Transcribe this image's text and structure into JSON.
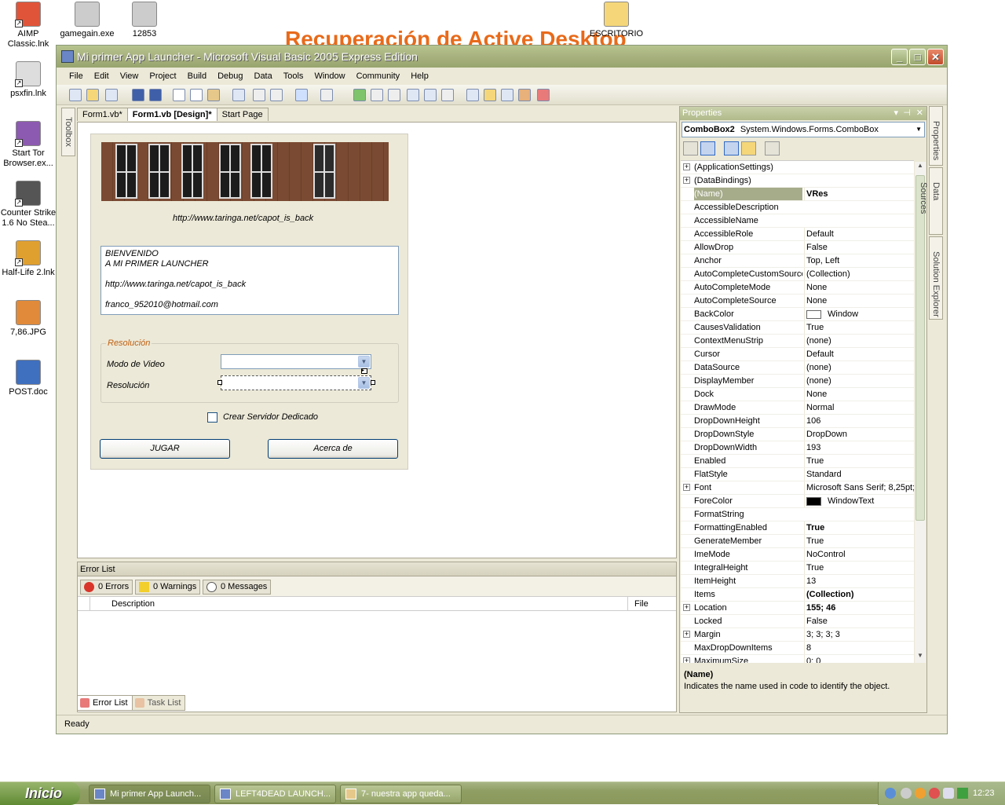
{
  "desktop": {
    "background_title": "Recuperación de Active Desktop",
    "icons": [
      {
        "label": "AIMP Classic.lnk",
        "icon": "aimp-icon"
      },
      {
        "label": "gamegain.exe",
        "icon": "recycle-icon"
      },
      {
        "label": "12853",
        "icon": "image-file-icon"
      },
      {
        "label": "ESCRITORIO",
        "icon": "folder-icon"
      },
      {
        "label": "psxfin.lnk",
        "icon": "psx-icon"
      },
      {
        "label": "Start Tor Browser.ex...",
        "icon": "tor-icon"
      },
      {
        "label": "Counter Strike 1.6 No Stea...",
        "icon": "cs-icon"
      },
      {
        "label": "Half-Life 2.lnk",
        "icon": "halflife-icon"
      },
      {
        "label": "7,86.JPG",
        "icon": "jpg-icon"
      },
      {
        "label": "POST.doc",
        "icon": "word-icon"
      }
    ]
  },
  "window": {
    "title": "Mi primer App Launcher - Microsoft Visual Basic 2005 Express Edition",
    "menu": [
      "File",
      "Edit",
      "View",
      "Project",
      "Build",
      "Debug",
      "Data",
      "Tools",
      "Window",
      "Community",
      "Help"
    ],
    "toolbox_label": "Toolbox",
    "tabs": [
      "Form1.vb*",
      "Form1.vb [Design]*",
      "Start Page"
    ],
    "status": "Ready"
  },
  "form": {
    "url_label": "http://www.taringa.net/capot_is_back",
    "textbox_lines": [
      "BIENVENIDO",
      "A MI PRIMER LAUNCHER",
      "",
      "http://www.taringa.net/capot_is_back",
      "",
      "franco_952010@hotmail.com"
    ],
    "group_title": "Resolución",
    "modo_label": "Modo de Video",
    "resolucion_label": "Resolución",
    "checkbox_label": "Crear Servidor Dedicado",
    "play_button": "JUGAR",
    "about_button": "Acerca de"
  },
  "error_list": {
    "title": "Error List",
    "errors": "0 Errors",
    "warnings": "0 Warnings",
    "messages": "0 Messages",
    "col_description": "Description",
    "col_file": "File",
    "tab_error": "Error List",
    "tab_task": "Task List"
  },
  "properties": {
    "title": "Properties",
    "object_name": "ComboBox2",
    "object_type": "System.Windows.Forms.ComboBox",
    "rows": [
      {
        "name": "(ApplicationSettings)",
        "value": "",
        "expand": true
      },
      {
        "name": "(DataBindings)",
        "value": "",
        "expand": true
      },
      {
        "name": "(Name)",
        "value": "VRes",
        "selected": true,
        "bold": true
      },
      {
        "name": "AccessibleDescription",
        "value": ""
      },
      {
        "name": "AccessibleName",
        "value": ""
      },
      {
        "name": "AccessibleRole",
        "value": "Default"
      },
      {
        "name": "AllowDrop",
        "value": "False"
      },
      {
        "name": "Anchor",
        "value": "Top, Left"
      },
      {
        "name": "AutoCompleteCustomSource",
        "value": "(Collection)"
      },
      {
        "name": "AutoCompleteMode",
        "value": "None"
      },
      {
        "name": "AutoCompleteSource",
        "value": "None"
      },
      {
        "name": "BackColor",
        "value": "Window",
        "swatch": "#ffffff"
      },
      {
        "name": "CausesValidation",
        "value": "True"
      },
      {
        "name": "ContextMenuStrip",
        "value": "(none)"
      },
      {
        "name": "Cursor",
        "value": "Default"
      },
      {
        "name": "DataSource",
        "value": "(none)"
      },
      {
        "name": "DisplayMember",
        "value": "(none)"
      },
      {
        "name": "Dock",
        "value": "None"
      },
      {
        "name": "DrawMode",
        "value": "Normal"
      },
      {
        "name": "DropDownHeight",
        "value": "106"
      },
      {
        "name": "DropDownStyle",
        "value": "DropDown"
      },
      {
        "name": "DropDownWidth",
        "value": "193"
      },
      {
        "name": "Enabled",
        "value": "True"
      },
      {
        "name": "FlatStyle",
        "value": "Standard"
      },
      {
        "name": "Font",
        "value": "Microsoft Sans Serif; 8,25pt;",
        "expand": true
      },
      {
        "name": "ForeColor",
        "value": "WindowText",
        "swatch": "#000000"
      },
      {
        "name": "FormatString",
        "value": ""
      },
      {
        "name": "FormattingEnabled",
        "value": "True",
        "bold": true
      },
      {
        "name": "GenerateMember",
        "value": "True"
      },
      {
        "name": "ImeMode",
        "value": "NoControl"
      },
      {
        "name": "IntegralHeight",
        "value": "True"
      },
      {
        "name": "ItemHeight",
        "value": "13"
      },
      {
        "name": "Items",
        "value": "(Collection)",
        "bold": true
      },
      {
        "name": "Location",
        "value": "155; 46",
        "bold": true,
        "expand": true
      },
      {
        "name": "Locked",
        "value": "False"
      },
      {
        "name": "Margin",
        "value": "3; 3; 3; 3",
        "expand": true
      },
      {
        "name": "MaxDropDownItems",
        "value": "8"
      },
      {
        "name": "MaximumSize",
        "value": "0; 0",
        "expand": true
      }
    ],
    "desc_title": "(Name)",
    "desc_text": "Indicates the name used in code to identify the object.",
    "side_tabs": [
      "Properties",
      "Data Sources",
      "Solution Explorer"
    ]
  },
  "taskbar": {
    "start": "Inicio",
    "tasks": [
      "Mi primer App Launch...",
      "LEFT4DEAD LAUNCH...",
      "7- nuestra app queda..."
    ],
    "clock": "12:23"
  }
}
